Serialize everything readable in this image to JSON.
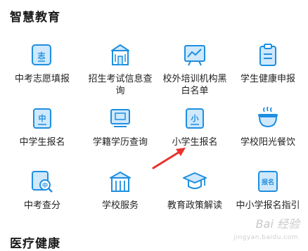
{
  "section": {
    "title": "智慧教育"
  },
  "next_section": {
    "title": "医疗健康"
  },
  "watermark": {
    "text": "Bai 经验",
    "sub": "jingyan.baidu.com"
  },
  "colors": {
    "icon_blue": "#1e8fe0",
    "icon_light": "#cfe8fb",
    "arrow_red": "#e8332d"
  },
  "services": [
    {
      "label": "中考志愿填报",
      "icon": "zhi-badge-icon",
      "glyph": "志"
    },
    {
      "label": "招生考试信息查询",
      "icon": "building-icon",
      "glyph": ""
    },
    {
      "label": "校外培训机构黑白名单",
      "icon": "chart-board-icon",
      "glyph": ""
    },
    {
      "label": "学生健康申报",
      "icon": "clipboard-icon",
      "glyph": ""
    },
    {
      "label": "中学生报名",
      "icon": "zhong-badge-icon",
      "glyph": "中"
    },
    {
      "label": "学籍学历查询",
      "icon": "certificate-icon",
      "glyph": ""
    },
    {
      "label": "小学生报名",
      "icon": "xiao-badge-icon",
      "glyph": "小"
    },
    {
      "label": "学校阳光餐饮",
      "icon": "food-bowl-icon",
      "glyph": ""
    },
    {
      "label": "中考查分",
      "icon": "search-score-icon",
      "glyph": "中"
    },
    {
      "label": "学校服务",
      "icon": "school-icon",
      "glyph": ""
    },
    {
      "label": "教育政策解读",
      "icon": "graduation-cap-icon",
      "glyph": ""
    },
    {
      "label": "中小学报名指引",
      "icon": "baoming-badge-icon",
      "glyph": "报名"
    }
  ]
}
